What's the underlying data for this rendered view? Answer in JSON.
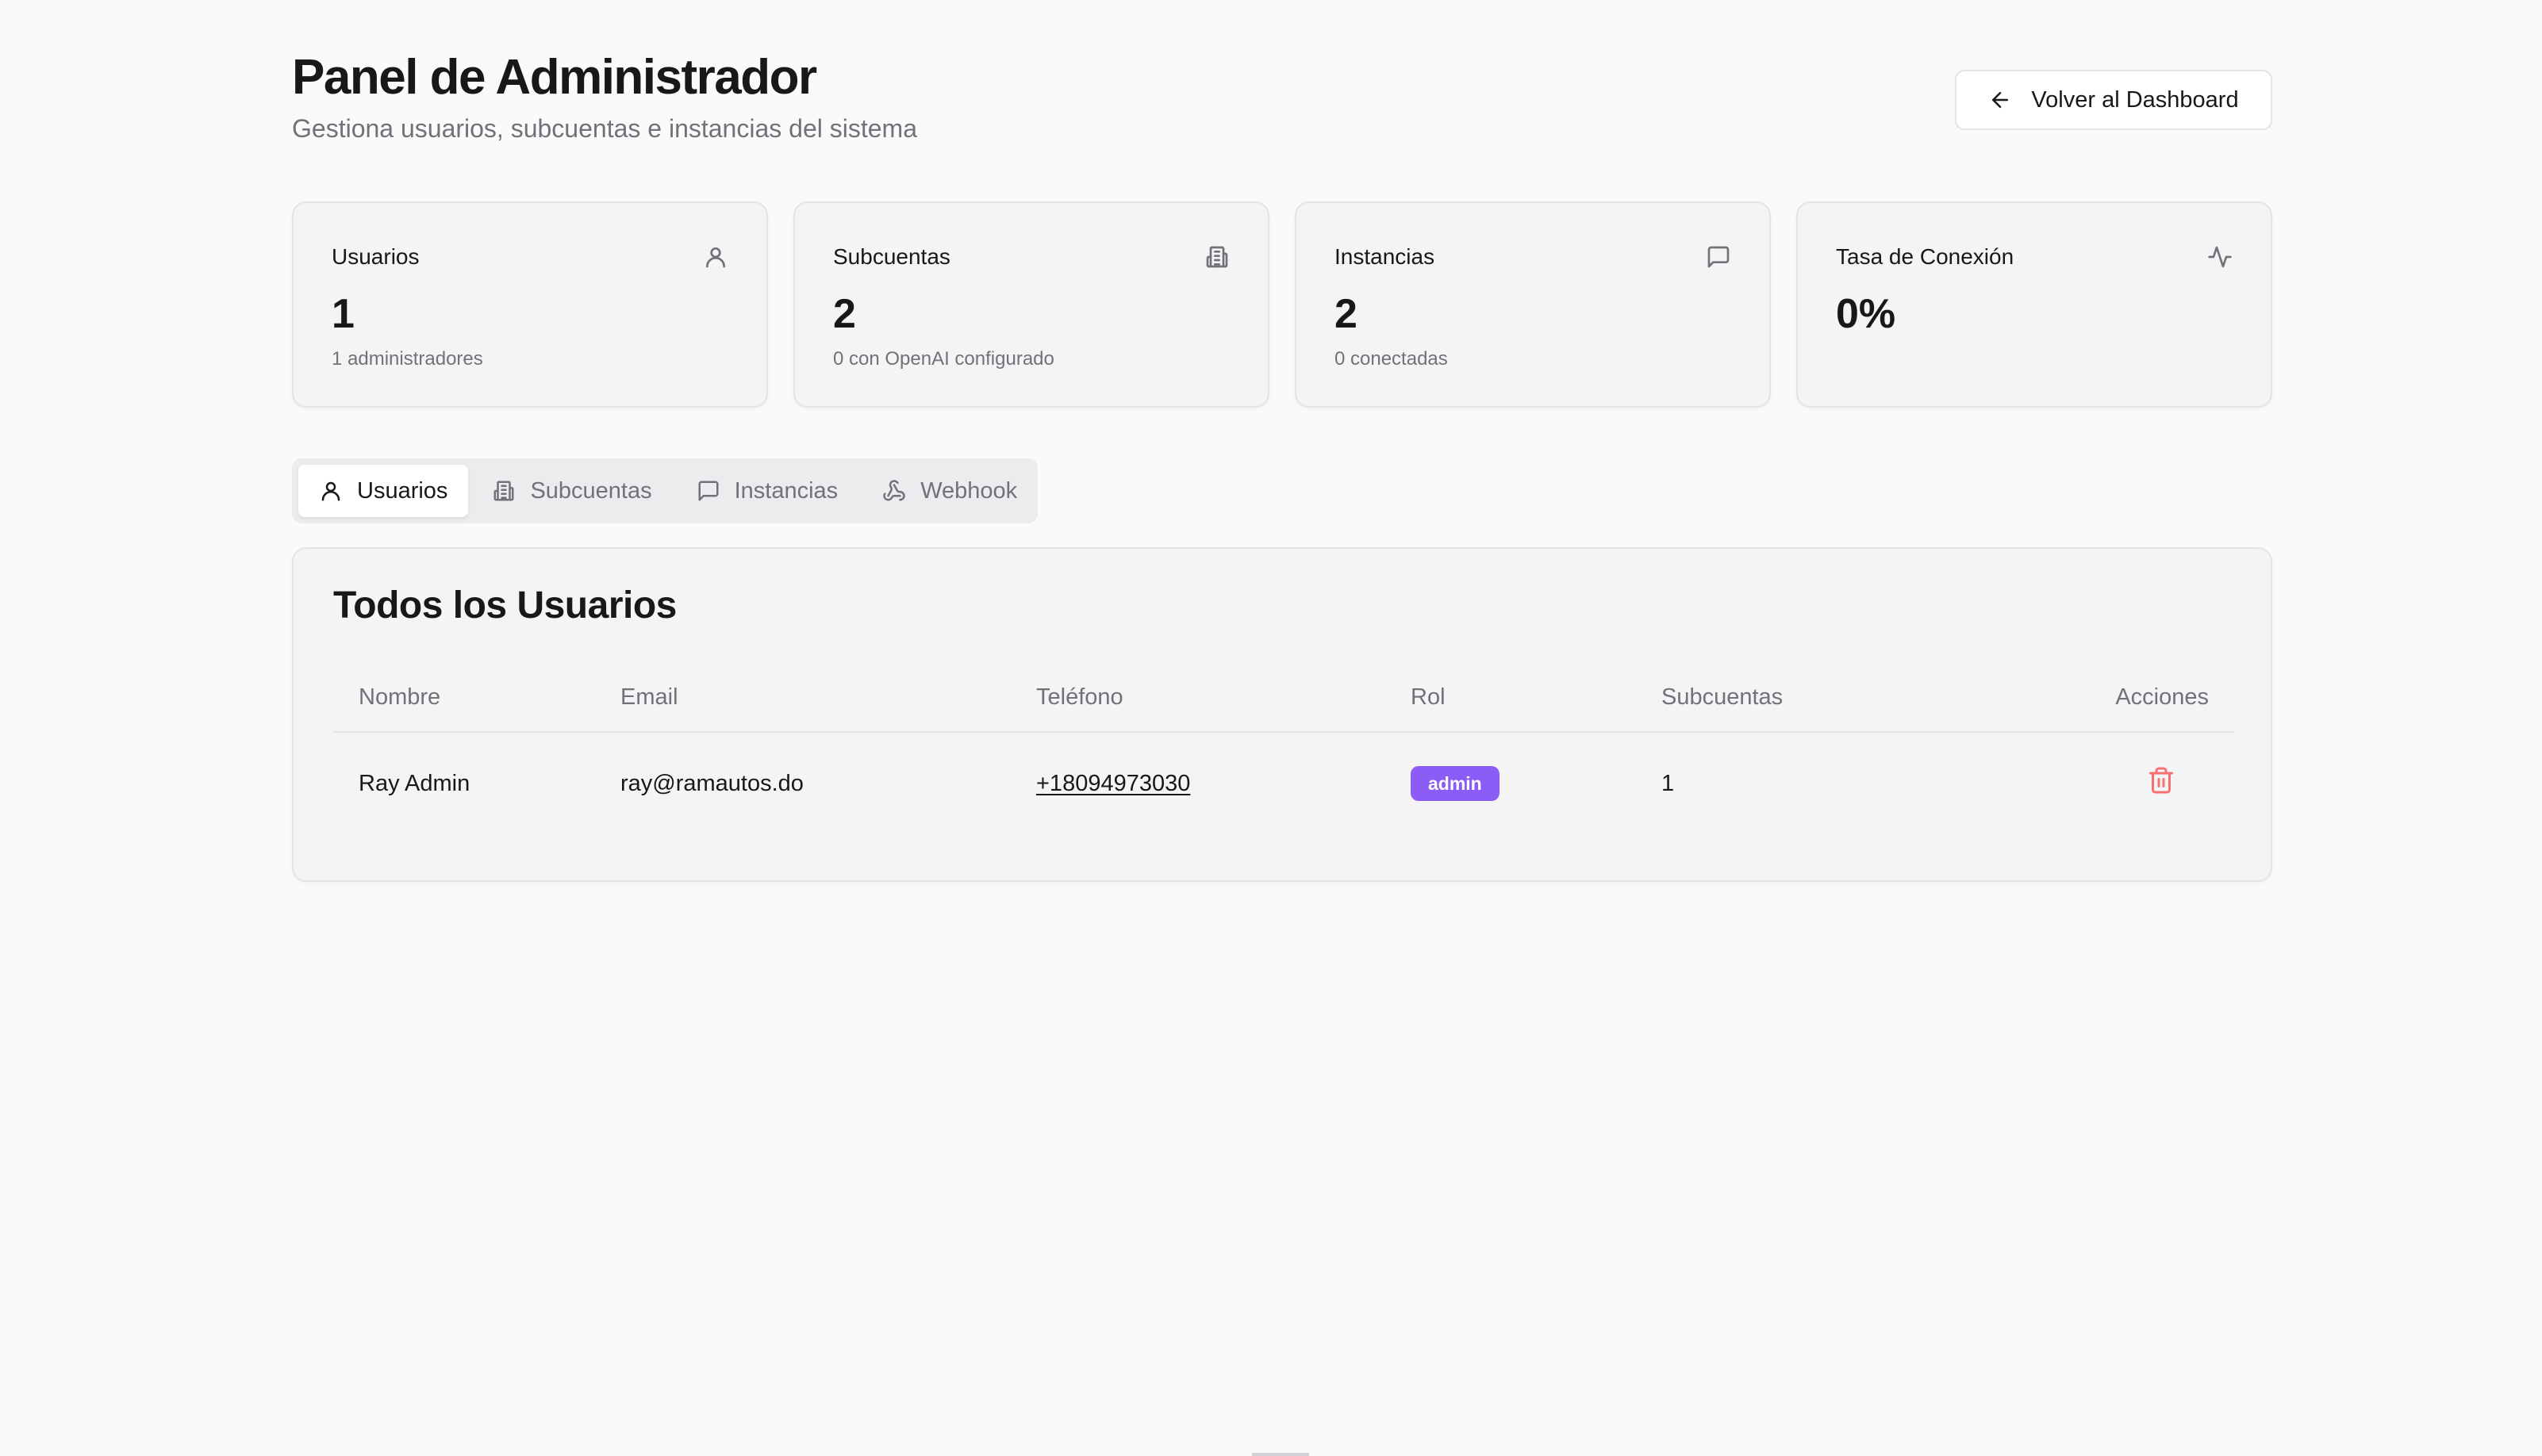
{
  "header": {
    "title": "Panel de Administrador",
    "subtitle": "Gestiona usuarios, subcuentas e instancias del sistema",
    "back_label": "Volver al Dashboard",
    "back_icon": "arrow-left-icon"
  },
  "stats": [
    {
      "label": "Usuarios",
      "value": "1",
      "note": "1 administradores",
      "icon": "user-icon"
    },
    {
      "label": "Subcuentas",
      "value": "2",
      "note": "0 con OpenAI configurado",
      "icon": "building-icon"
    },
    {
      "label": "Instancias",
      "value": "2",
      "note": "0 conectadas",
      "icon": "message-square-icon"
    },
    {
      "label": "Tasa de Conexión",
      "value": "0%",
      "note": "",
      "icon": "activity-icon"
    }
  ],
  "tabs": [
    {
      "label": "Usuarios",
      "icon": "user-icon",
      "active": true
    },
    {
      "label": "Subcuentas",
      "icon": "building-icon",
      "active": false
    },
    {
      "label": "Instancias",
      "icon": "message-square-icon",
      "active": false
    },
    {
      "label": "Webhook",
      "icon": "webhook-icon",
      "active": false
    }
  ],
  "panel": {
    "title": "Todos los Usuarios",
    "columns": [
      "Nombre",
      "Email",
      "Teléfono",
      "Rol",
      "Subcuentas",
      "Acciones"
    ],
    "rows": [
      {
        "name": "Ray Admin",
        "email": "ray@ramautos.do",
        "phone": "+18094973030",
        "role": "admin",
        "subaccounts": "1",
        "action_icon": "trash-icon"
      }
    ]
  },
  "colors": {
    "background": "#fafafa",
    "card": "#f4f4f5",
    "border": "#e4e4e7",
    "muted_text": "#71717a",
    "role_badge": "#8b5cf6",
    "delete": "#f87171"
  }
}
